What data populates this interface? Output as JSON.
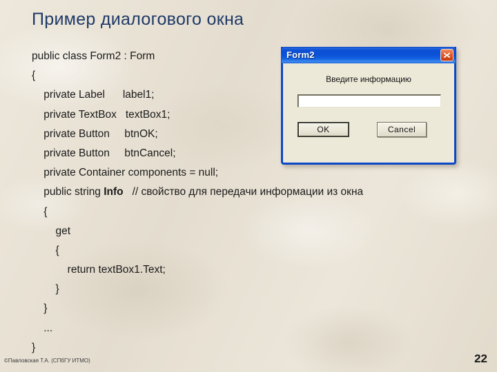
{
  "slide": {
    "title": "Пример диалогового окна",
    "number": "22",
    "copyright": "©Павловская Т.А. (СПбГУ ИТМО)"
  },
  "code": {
    "lines": [
      {
        "text": "public class Form2 : Form",
        "bold": ""
      },
      {
        "text": "{",
        "bold": ""
      },
      {
        "text": "    private Label      label1;",
        "bold": ""
      },
      {
        "text": "    private TextBox   textBox1;",
        "bold": ""
      },
      {
        "text": "    private Button     btnOK;",
        "bold": ""
      },
      {
        "text": "    private Button     btnCancel;",
        "bold": ""
      },
      {
        "text": "    private Container components = null;",
        "bold": ""
      },
      {
        "text": "    public string ",
        "bold": "Info",
        "after": "   // свойство для передачи информации из окна"
      },
      {
        "text": "    {",
        "bold": ""
      },
      {
        "text": "        get",
        "bold": ""
      },
      {
        "text": "        {",
        "bold": ""
      },
      {
        "text": "            return textBox1.Text;",
        "bold": ""
      },
      {
        "text": "        }",
        "bold": ""
      },
      {
        "text": "    }",
        "bold": ""
      },
      {
        "text": "    ...",
        "bold": ""
      },
      {
        "text": "}",
        "bold": ""
      }
    ]
  },
  "dialog": {
    "title": "Form2",
    "close_icon": "close-x-icon",
    "prompt_label": "Введите информацию",
    "textbox_value": "",
    "textbox_placeholder": "",
    "ok_label": "OK",
    "cancel_label": "Cancel"
  },
  "colors": {
    "title_blue": "#1f3a68",
    "titlebar_blue": "#0b4fd4",
    "close_red": "#e25a2a",
    "background": "#e9e3d6",
    "dialog_face": "#ece9d8"
  }
}
